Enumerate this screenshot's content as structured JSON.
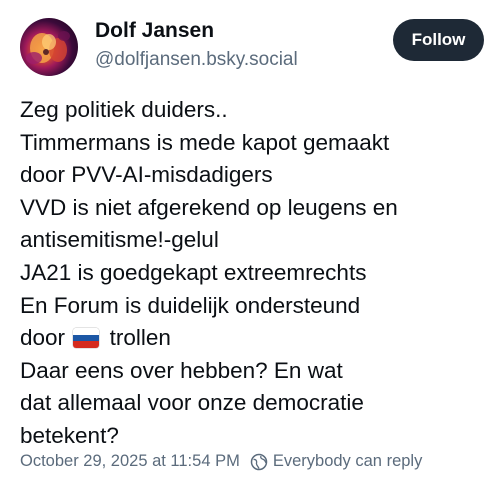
{
  "author": {
    "display_name": "Dolf Jansen",
    "handle": "@dolfjansen.bsky.social",
    "avatar_icon": "avatar-photo"
  },
  "follow_button": {
    "label": "Follow"
  },
  "post": {
    "lines": [
      "Zeg politiek duiders..",
      "Timmermans is mede kapot gemaakt",
      "door PVV-AI-misdadigers",
      "VVD is niet afgerekend op leugens en",
      "antisemitisme!-gelul",
      "JA21 is goedgekapt extreemrechts",
      "En Forum is duidelijk ondersteund",
      "door",
      "trollen",
      "Daar eens over hebben? En wat",
      "dat allemaal voor onze democratie",
      "betekent?"
    ],
    "flag_icon": "russia-flag-icon"
  },
  "footer": {
    "timestamp": "October 29, 2025 at 11:54 PM",
    "reply_setting": "Everybody can reply",
    "reply_icon": "globe-icon"
  },
  "colors": {
    "text": "#0b0f14",
    "muted": "#5b6b7c",
    "button_bg": "#1e2936",
    "button_text": "#ffffff"
  }
}
